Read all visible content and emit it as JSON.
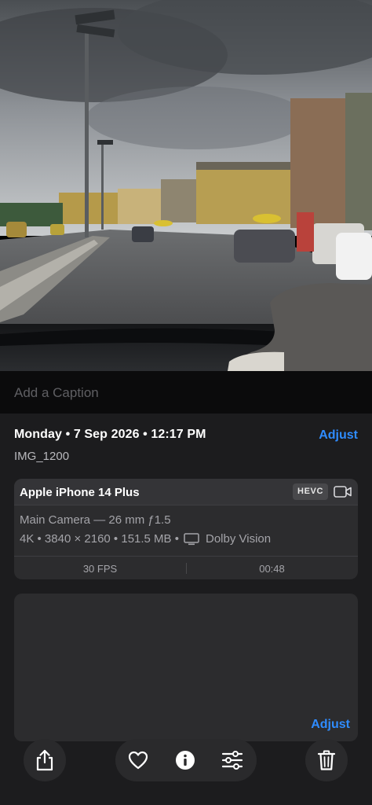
{
  "caption": {
    "placeholder": "Add a Caption"
  },
  "info": {
    "date_time": "Monday • 7 Sep 2026 • 12:17 PM",
    "file_name": "IMG_1200",
    "adjust_label": "Adjust"
  },
  "device_card": {
    "device_name": "Apple iPhone 14 Plus",
    "codec_badge": "HEVC",
    "lens": "Main Camera — 26 mm ƒ1.5",
    "resolution_size": "4K • 3840 × 2160 • 151.5 MB •",
    "hdr": "Dolby Vision",
    "fps": "30 FPS",
    "duration": "00:48"
  },
  "location_card": {
    "adjust_label": "Adjust"
  },
  "toolbar": {
    "share_icon": "share-icon",
    "favorite_icon": "heart-icon",
    "info_icon": "info-icon",
    "edit_icon": "sliders-icon",
    "delete_icon": "trash-icon"
  },
  "colors": {
    "accent": "#2f8cff",
    "sheet_bg": "#1c1c1e",
    "card_bg": "#2c2c2e"
  }
}
